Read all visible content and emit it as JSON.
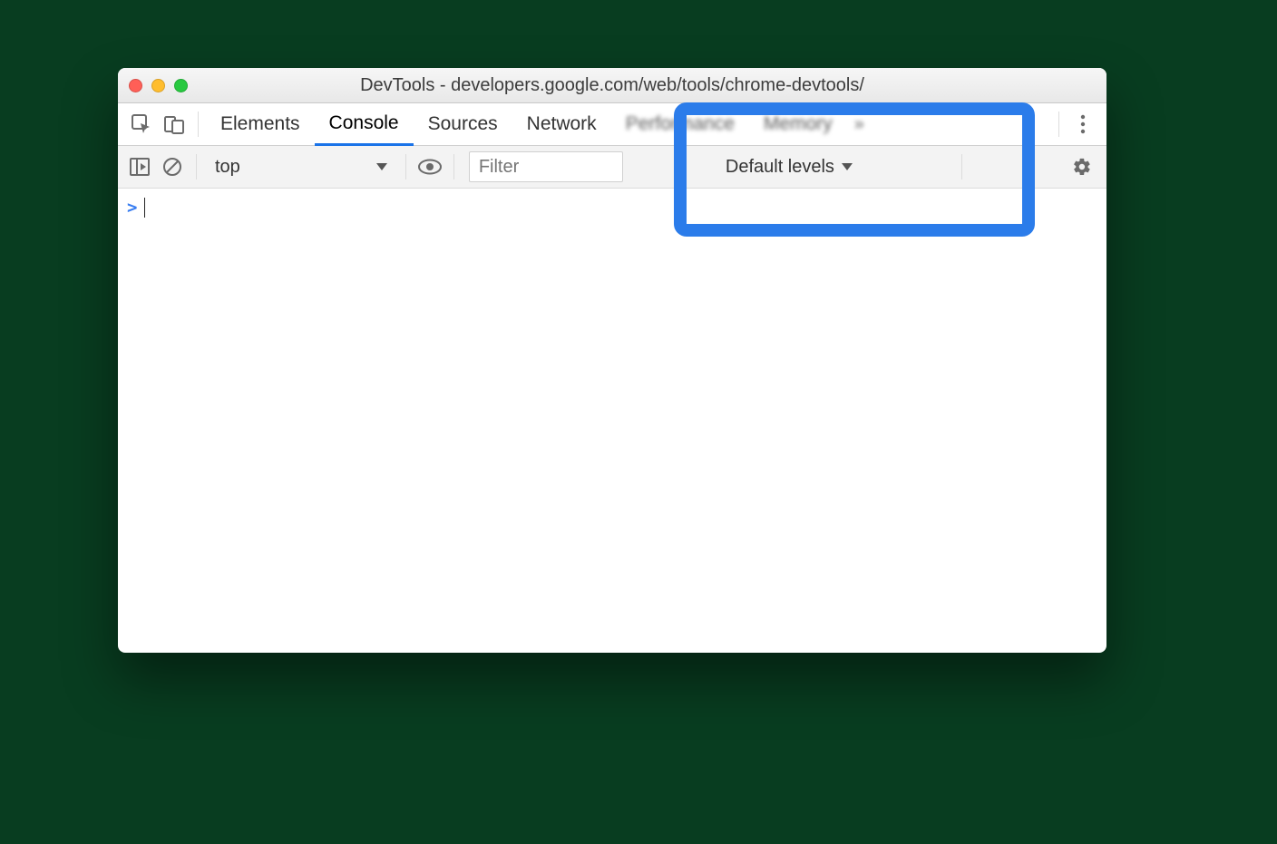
{
  "window": {
    "title": "DevTools - developers.google.com/web/tools/chrome-devtools/"
  },
  "tabs": {
    "elements": "Elements",
    "console": "Console",
    "sources": "Sources",
    "network": "Network",
    "performance": "Performance",
    "memory": "Memory"
  },
  "console_toolbar": {
    "context": "top",
    "filter_placeholder": "Filter",
    "levels": "Default levels"
  },
  "prompt": ">"
}
